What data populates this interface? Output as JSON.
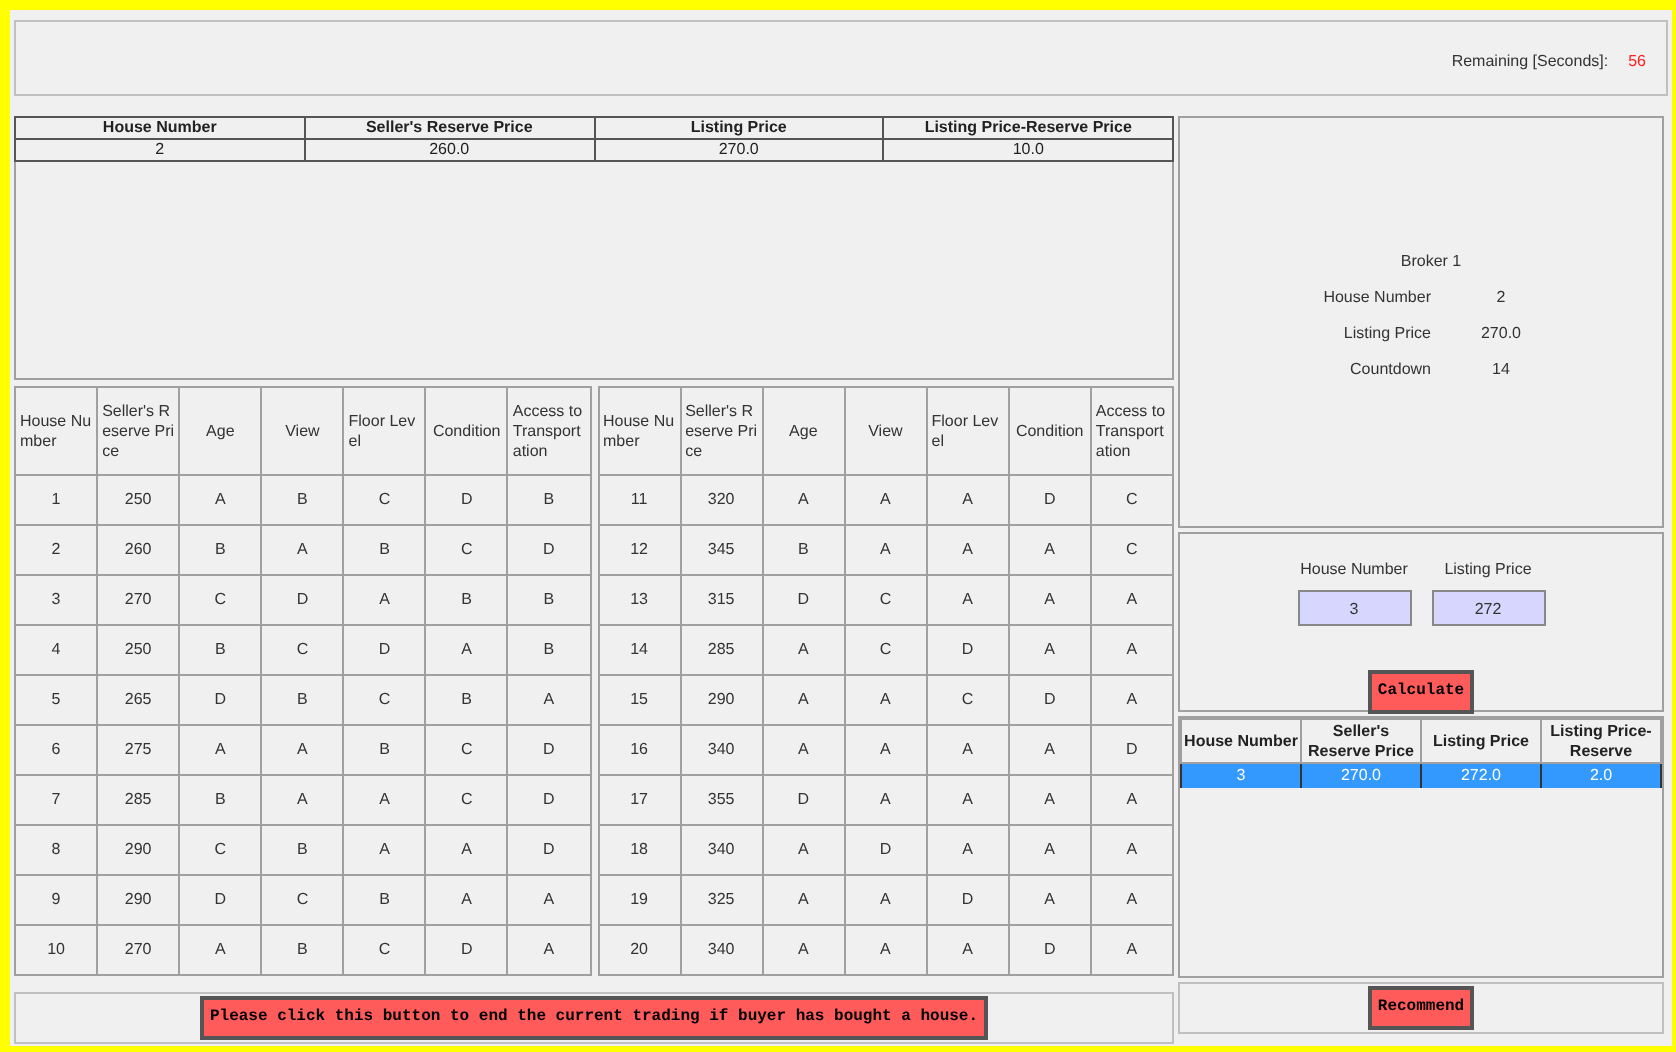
{
  "remaining": {
    "label": "Remaining [Seconds]:",
    "value": "56"
  },
  "current_house": {
    "columns": [
      "House Number",
      "Seller's Reserve Price",
      "Listing Price",
      "Listing Price-Reserve Price"
    ],
    "row": [
      "2",
      "260.0",
      "270.0",
      "10.0"
    ]
  },
  "house_tables": [
    {
      "columns": [
        "House Number",
        "Seller's Reserve Price",
        "Age",
        "View",
        "Floor Level",
        "Condition",
        "Access to Transportation"
      ],
      "rows": [
        [
          "1",
          "250",
          "A",
          "B",
          "C",
          "D",
          "B"
        ],
        [
          "2",
          "260",
          "B",
          "A",
          "B",
          "C",
          "D"
        ],
        [
          "3",
          "270",
          "C",
          "D",
          "A",
          "B",
          "B"
        ],
        [
          "4",
          "250",
          "B",
          "C",
          "D",
          "A",
          "B"
        ],
        [
          "5",
          "265",
          "D",
          "B",
          "C",
          "B",
          "A"
        ],
        [
          "6",
          "275",
          "A",
          "A",
          "B",
          "C",
          "D"
        ],
        [
          "7",
          "285",
          "B",
          "A",
          "A",
          "C",
          "D"
        ],
        [
          "8",
          "290",
          "C",
          "B",
          "A",
          "A",
          "D"
        ],
        [
          "9",
          "290",
          "D",
          "C",
          "B",
          "A",
          "A"
        ],
        [
          "10",
          "270",
          "A",
          "B",
          "C",
          "D",
          "A"
        ]
      ]
    },
    {
      "columns": [
        "House Number",
        "Seller's Reserve Price",
        "Age",
        "View",
        "Floor Level",
        "Condition",
        "Access to Transportation"
      ],
      "rows": [
        [
          "11",
          "320",
          "A",
          "A",
          "A",
          "D",
          "C"
        ],
        [
          "12",
          "345",
          "B",
          "A",
          "A",
          "A",
          "C"
        ],
        [
          "13",
          "315",
          "D",
          "C",
          "A",
          "A",
          "A"
        ],
        [
          "14",
          "285",
          "A",
          "C",
          "D",
          "A",
          "A"
        ],
        [
          "15",
          "290",
          "A",
          "A",
          "C",
          "D",
          "A"
        ],
        [
          "16",
          "340",
          "A",
          "A",
          "A",
          "A",
          "D"
        ],
        [
          "17",
          "355",
          "D",
          "A",
          "A",
          "A",
          "A"
        ],
        [
          "18",
          "340",
          "A",
          "D",
          "A",
          "A",
          "A"
        ],
        [
          "19",
          "325",
          "A",
          "A",
          "D",
          "A",
          "A"
        ],
        [
          "20",
          "340",
          "A",
          "A",
          "A",
          "D",
          "A"
        ]
      ]
    }
  ],
  "end_button": "Please click this button to end the current trading if buyer has bought a house.",
  "broker": {
    "title": "Broker 1",
    "fields": [
      {
        "label": "House Number",
        "value": "2"
      },
      {
        "label": "Listing Price",
        "value": "270.0"
      },
      {
        "label": "Countdown",
        "value": "14"
      }
    ]
  },
  "inputs": [
    {
      "label": "House Number",
      "value": "3"
    },
    {
      "label": "Listing Price",
      "value": "272"
    }
  ],
  "calculate_button": "Calculate",
  "result_table": {
    "columns": [
      "House Number",
      "Seller's Reserve Price",
      "Listing Price",
      "Listing Price-Reserve"
    ],
    "rows": [
      {
        "cells": [
          "3",
          "270.0",
          "272.0",
          "2.0"
        ],
        "selected": true
      }
    ]
  },
  "recommend_button": "Recommend"
}
